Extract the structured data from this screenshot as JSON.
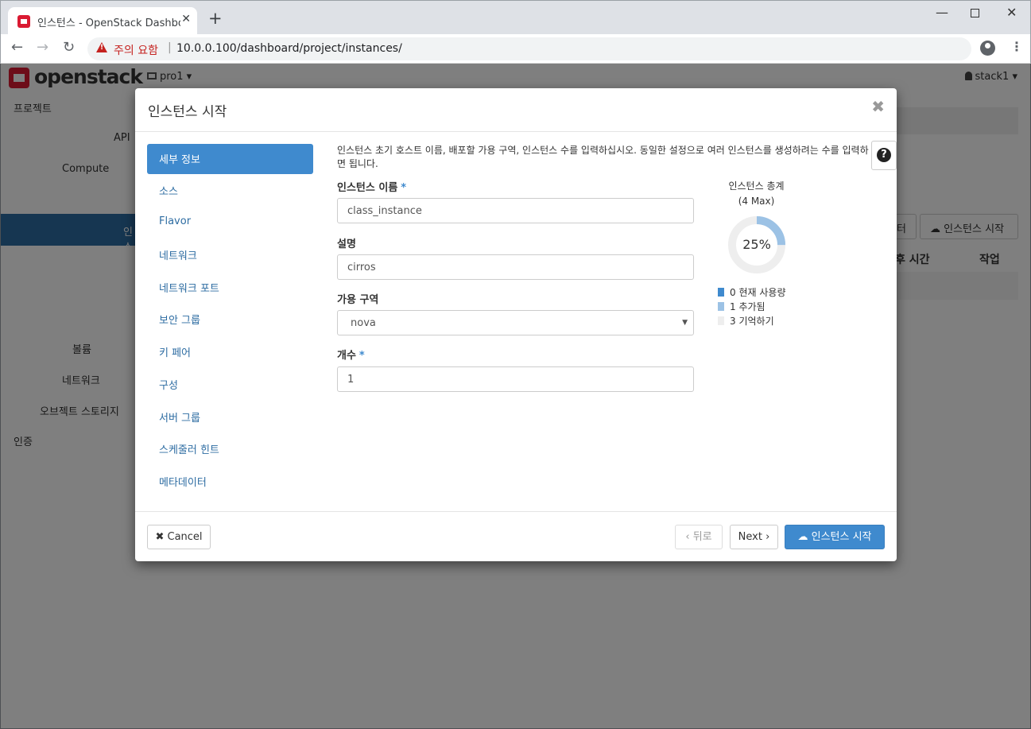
{
  "browser": {
    "tab_title": "인스턴스 - OpenStack Dashboar",
    "security_warning": "주의 요함",
    "url": "10.0.0.100/dashboard/project/instances/"
  },
  "header": {
    "logo_text": "openstack",
    "project": "pro1",
    "user": "stack1"
  },
  "sidebar": {
    "items": [
      "프로젝트",
      "API",
      "Compute",
      "인스",
      "볼륨",
      "네트워크",
      "오브젝트 스토리지",
      "인증"
    ]
  },
  "background": {
    "filter_label": "터",
    "launch_button": "인스턴스 시작",
    "columns": [
      "후 시간",
      "작업"
    ]
  },
  "modal": {
    "title": "인스턴스 시작",
    "steps": [
      "세부 정보",
      "소스",
      "Flavor",
      "네트워크",
      "네트워크 포트",
      "보안 그룹",
      "키 페어",
      "구성",
      "서버 그룹",
      "스케줄러 힌트",
      "메타데이터"
    ],
    "active_step": 0,
    "help_text": "인스턴스 초기 호스트 이름, 배포할 가용 구역, 인스턴스 수를 입력하십시오. 동일한 설정으로 여러 인스턴스를 생성하려는 수를 입력하면 됩니다.",
    "fields": {
      "name": {
        "label": "인스턴스 이름",
        "value": "class_instance"
      },
      "description": {
        "label": "설명",
        "value": "cirros"
      },
      "zone": {
        "label": "가용 구역",
        "value": "nova"
      },
      "count": {
        "label": "개수",
        "value": "1"
      }
    },
    "quota": {
      "title": "인스턴스 총계",
      "subtitle": "(4 Max)",
      "percent": 25,
      "percent_text": "25%",
      "legend": [
        {
          "value": "0",
          "label": "현재 사용량",
          "color": "#3f8ace"
        },
        {
          "value": "1",
          "label": "추가됨",
          "color": "#9cc2e5"
        },
        {
          "value": "3",
          "label": "기억하기",
          "color": "#eeeeee"
        }
      ]
    },
    "buttons": {
      "cancel": "Cancel",
      "back": "뒤로",
      "next": "Next",
      "launch": "인스턴스 시작"
    }
  }
}
